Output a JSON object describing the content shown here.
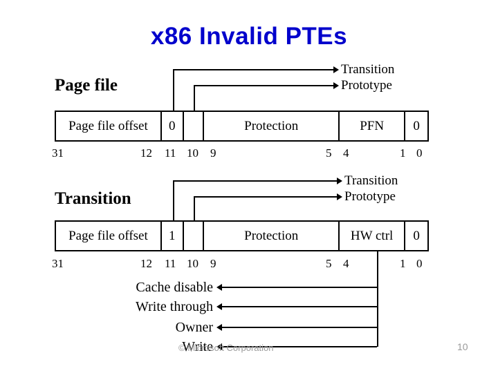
{
  "slide": {
    "title": "x86 Invalid PTEs",
    "title_color": "#0000cc",
    "background": "#ffffff"
  },
  "sections": [
    {
      "heading": "Page file",
      "callouts": [
        {
          "label": "Transition"
        },
        {
          "label": "Prototype"
        }
      ],
      "table": {
        "cells": [
          {
            "label": "Page file offset"
          },
          {
            "label": "0"
          },
          {
            "label": ""
          },
          {
            "label": "Protection"
          },
          {
            "label": "PFN"
          },
          {
            "label": "0"
          }
        ]
      },
      "bits": [
        {
          "label": "31"
        },
        {
          "label": "12"
        },
        {
          "label": "11"
        },
        {
          "label": "10"
        },
        {
          "label": "9"
        },
        {
          "label": "5"
        },
        {
          "label": "4"
        },
        {
          "label": "1"
        },
        {
          "label": "0"
        }
      ]
    },
    {
      "heading": "Transition",
      "callouts": [
        {
          "label": "Transition"
        },
        {
          "label": "Prototype"
        }
      ],
      "table": {
        "cells": [
          {
            "label": "Page file offset"
          },
          {
            "label": "1"
          },
          {
            "label": ""
          },
          {
            "label": "Protection"
          },
          {
            "label": "HW ctrl"
          },
          {
            "label": "0"
          }
        ]
      },
      "bits": [
        {
          "label": "31"
        },
        {
          "label": "12"
        },
        {
          "label": "11"
        },
        {
          "label": "10"
        },
        {
          "label": "9"
        },
        {
          "label": "5"
        },
        {
          "label": "4"
        },
        {
          "label": "1"
        },
        {
          "label": "0"
        }
      ]
    }
  ],
  "hw_ctrl_bits": [
    {
      "label": "Cache disable"
    },
    {
      "label": "Write through"
    },
    {
      "label": "Owner"
    },
    {
      "label": "Write"
    }
  ],
  "footer": {
    "copyright": "© Microsoft Corporation",
    "page_number": "10"
  }
}
